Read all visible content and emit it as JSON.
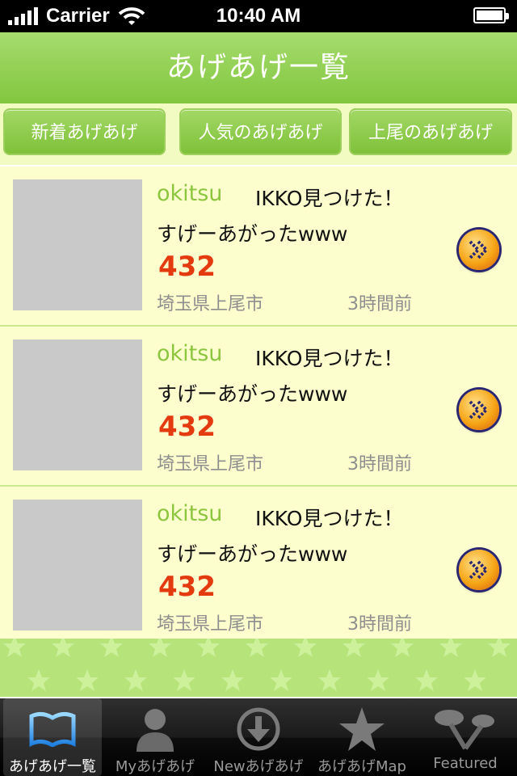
{
  "status_bar": {
    "carrier": "Carrier",
    "time": "10:40 AM"
  },
  "header": {
    "title": "あげあげ一覧"
  },
  "segments": [
    {
      "label": "新着あげあげ"
    },
    {
      "label": "人気のあげあげ"
    },
    {
      "label": "上尾のあげあげ"
    }
  ],
  "posts": [
    {
      "username": "okitsu",
      "message_line1": "IKKO見つけた！",
      "message_line2": "すげーあがったwww",
      "count": "432",
      "location": "埼玉県上尾市",
      "time_ago": "3時間前",
      "action_icon": "forward-arrow-icon"
    },
    {
      "username": "okitsu",
      "message_line1": "IKKO見つけた！",
      "message_line2": "すげーあがったwww",
      "count": "432",
      "location": "埼玉県上尾市",
      "time_ago": "3時間前",
      "action_icon": "forward-arrow-icon"
    },
    {
      "username": "okitsu",
      "message_line1": "IKKO見つけた！",
      "message_line2": "すげーあがったwww",
      "count": "432",
      "location": "埼玉県上尾市",
      "time_ago": "3時間前",
      "action_icon": "forward-arrow-icon"
    }
  ],
  "tabbar": {
    "items": [
      {
        "label": "あげあげ一覧",
        "icon": "book-icon",
        "selected": true
      },
      {
        "label": "Myあげあげ",
        "icon": "person-icon",
        "selected": false
      },
      {
        "label": "Newあげあげ",
        "icon": "download-icon",
        "selected": false
      },
      {
        "label": "あげあげMap",
        "icon": "star-icon",
        "selected": false
      },
      {
        "label": "Featured",
        "icon": "featured-icon",
        "selected": false
      }
    ]
  },
  "colors": {
    "header_green": "#8fcc4f",
    "list_background": "#fcfece",
    "username_green": "#8cc63e",
    "count_red": "#e43a10"
  }
}
